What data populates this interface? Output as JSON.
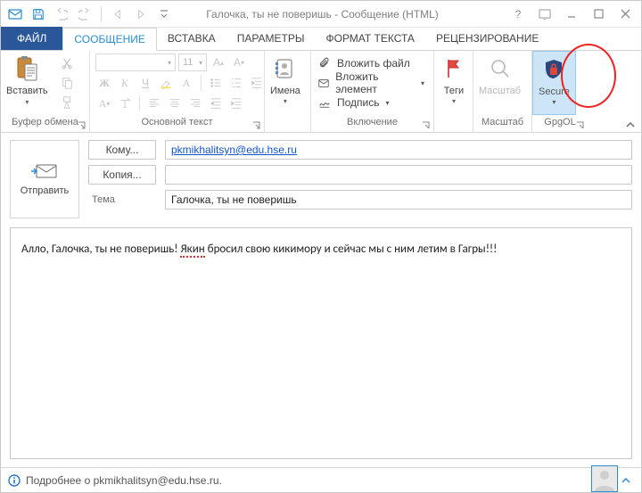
{
  "window": {
    "title": "Галочка, ты не поверишь - Сообщение (HTML)"
  },
  "qat": {
    "save": "save",
    "undo": "undo",
    "redo": "redo",
    "prev": "prev",
    "next": "next"
  },
  "tabs": {
    "file": "ФАЙЛ",
    "message": "СООБЩЕНИЕ",
    "insert": "ВСТАВКА",
    "options": "ПАРАМЕТРЫ",
    "format": "ФОРМАТ ТЕКСТА",
    "review": "РЕЦЕНЗИРОВАНИЕ"
  },
  "ribbon": {
    "clipboard": {
      "paste": "Вставить",
      "label": "Буфер обмена"
    },
    "font": {
      "family_placeholder": "",
      "size_placeholder": "11",
      "label": "Основной текст"
    },
    "names": {
      "button": "Имена",
      "label": ""
    },
    "include": {
      "attach_file": "Вложить файл",
      "attach_item": "Вложить элемент",
      "signature": "Подпись",
      "label": "Включение"
    },
    "tags": {
      "button": "Теги",
      "label": ""
    },
    "zoom": {
      "button": "Масштаб",
      "label": "Масштаб"
    },
    "gpg": {
      "button": "Secure",
      "label": "GpgOL"
    }
  },
  "compose": {
    "send": "Отправить",
    "to_label": "Кому...",
    "cc_label": "Копия...",
    "subject_label": "Тема",
    "to_value": "pkmikhalitsyn@edu.hse.ru",
    "cc_value": "",
    "subject_value": "Галочка, ты не поверишь",
    "body_prefix": "Алло, Галочка, ты не поверишь! ",
    "body_misspelled": "Якин",
    "body_suffix": " бросил свою кикимору и сейчас мы с ним летим в Гагры!!!"
  },
  "status": {
    "text": "Подробнее о pkmikhalitsyn@edu.hse.ru."
  }
}
